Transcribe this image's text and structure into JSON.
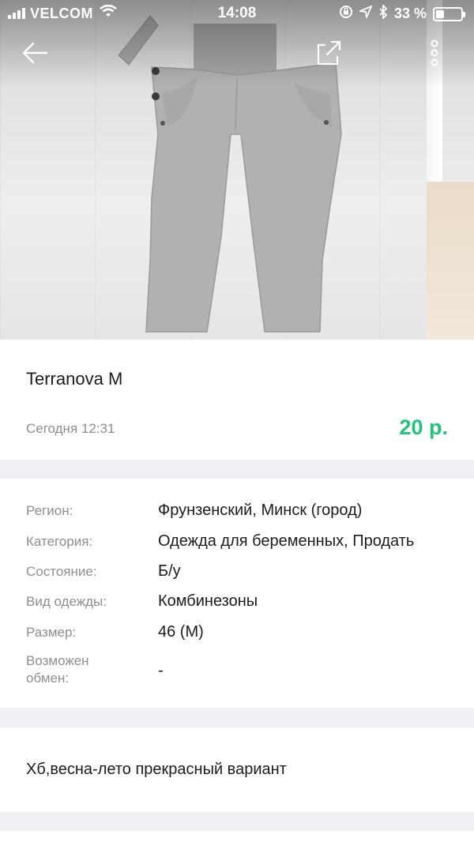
{
  "status_bar": {
    "carrier": "VELCOM",
    "time": "14:08",
    "battery": "33 %"
  },
  "photo": {
    "description_icon": "overalls-photo"
  },
  "toolbar": {
    "back_icon": "arrow-left-icon",
    "share_icon": "share-icon",
    "more_icon": "more-vertical-icon"
  },
  "listing": {
    "title": "Terranova M",
    "date": "Сегодня 12:31",
    "price": "20 р.",
    "price_color": "#23c47a"
  },
  "details": [
    {
      "label": "Регион:",
      "value": "Фрунзенский, Минск (город)"
    },
    {
      "label": "Категория:",
      "value": "Одежда для беременных, Продать"
    },
    {
      "label": "Состояние:",
      "value": "Б/у"
    },
    {
      "label": "Вид одежды:",
      "value": "Комбинезоны"
    },
    {
      "label": "Размер:",
      "value": "46 (M)"
    },
    {
      "label": "Возможен обмен:",
      "value": "-"
    }
  ],
  "description": {
    "text": "Хб,весна-лето прекрасный вариант"
  }
}
